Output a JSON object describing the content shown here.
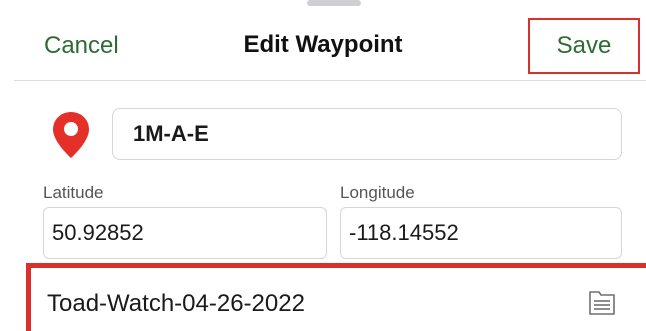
{
  "header": {
    "cancel_label": "Cancel",
    "title": "Edit Waypoint",
    "save_label": "Save"
  },
  "waypoint": {
    "name": "1M-A-E",
    "icon": "map-pin-icon",
    "pin_color": "#e5302a"
  },
  "coordinates": {
    "latitude_label": "Latitude",
    "latitude_value": "50.92852",
    "longitude_label": "Longitude",
    "longitude_value": "-118.14552"
  },
  "folder": {
    "name": "Toad-Watch-04-26-2022",
    "icon": "folder-list-icon"
  },
  "colors": {
    "accent_green": "#2e6b34",
    "highlight_red": "#d9302b"
  }
}
